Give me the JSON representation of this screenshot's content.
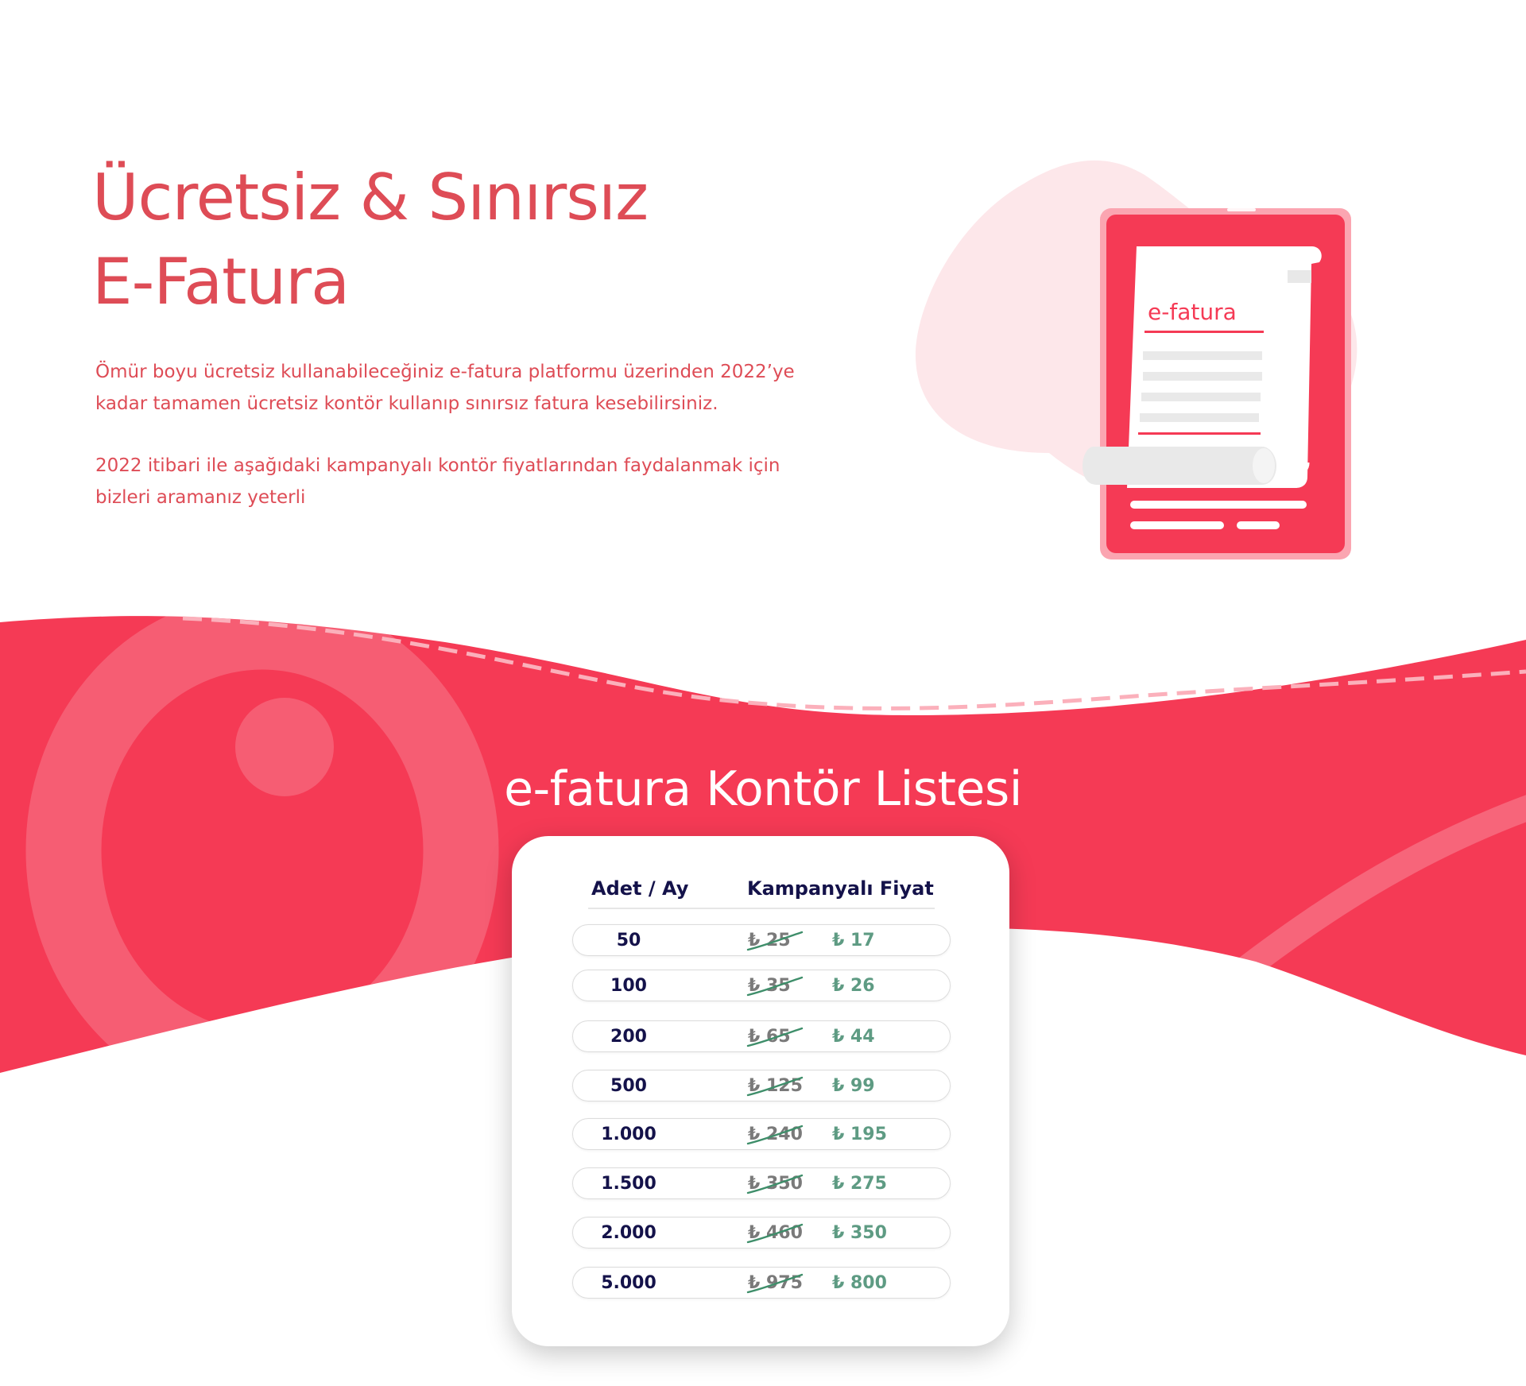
{
  "hero": {
    "title_line1": "Ücretsiz & Sınırsız",
    "title_line2": "E-Fatura",
    "desc1_line1": "Ömür boyu ücretsiz kullanabileceğiniz e-fatura platformu üzerinden 2022’ye",
    "desc1_line2": "kadar tamamen ücretsiz kontör kullanıp sınırsız fatura kesebilirsiniz.",
    "desc2_line1": "2022 itibari ile aşağıdaki kampanyalı kontör fiyatlarından faydalanmak için",
    "desc2_line2": "bizleri aramanız yeterli"
  },
  "illustration": {
    "doc_label": "e-fatura",
    "currency_symbol": "₺"
  },
  "price_list": {
    "title": "e-fatura Kontör Listesi",
    "col_qty": "Adet / Ay",
    "col_price": "Kampanyalı Fiyat",
    "rows": [
      {
        "qty": "50",
        "old": "₺ 25",
        "new": "₺ 17"
      },
      {
        "qty": "100",
        "old": "₺ 35",
        "new": "₺ 26"
      },
      {
        "qty": "200",
        "old": "₺ 65",
        "new": "₺ 44"
      },
      {
        "qty": "500",
        "old": "₺ 125",
        "new": "₺ 99"
      },
      {
        "qty": "1.000",
        "old": "₺ 240",
        "new": "₺ 195"
      },
      {
        "qty": "1.500",
        "old": "₺ 350",
        "new": "₺ 275"
      },
      {
        "qty": "2.000",
        "old": "₺ 460",
        "new": "₺ 350"
      },
      {
        "qty": "5.000",
        "old": "₺ 975",
        "new": "₺ 800"
      }
    ]
  },
  "colors": {
    "brand_red": "#F53A55",
    "title_red": "#DE4C56",
    "navy": "#14124A",
    "green": "#5E9B83",
    "strike_green": "#3E8E6A"
  }
}
